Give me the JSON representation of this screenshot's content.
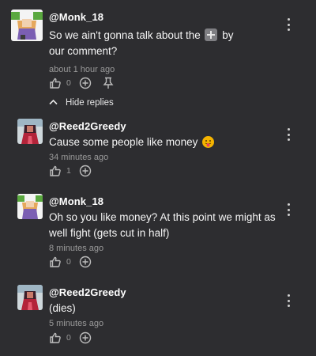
{
  "comments": [
    {
      "handle": "@Monk_18",
      "text_before": "So we ain't gonna talk about the",
      "text_after": "by",
      "text_line2": "our comment?",
      "inline_icon": "heavy-plus-sign-emoji",
      "time": "about 1 hour ago",
      "likes": "0",
      "has_pin": true
    },
    {
      "handle": "@Reed2Greedy",
      "text": "Cause some people like money",
      "inline_icon": "tongue-out-emoji",
      "time": "34 minutes ago",
      "likes": "1"
    },
    {
      "handle": "@Monk_18",
      "text_line1": "Oh so you like money? At this point we might as",
      "text_line2": "well fight (gets cut in half)",
      "time": "8 minutes ago",
      "likes": "0"
    },
    {
      "handle": "@Reed2Greedy",
      "text": "(dies)",
      "time": "5 minutes ago",
      "likes": "0"
    }
  ],
  "replies_toggle": {
    "label": "Hide replies",
    "icon": "chevron-up-icon"
  },
  "colors": {
    "background": "#2d2d30",
    "meta": "#9a9a9a",
    "text": "#f5f5f5"
  }
}
